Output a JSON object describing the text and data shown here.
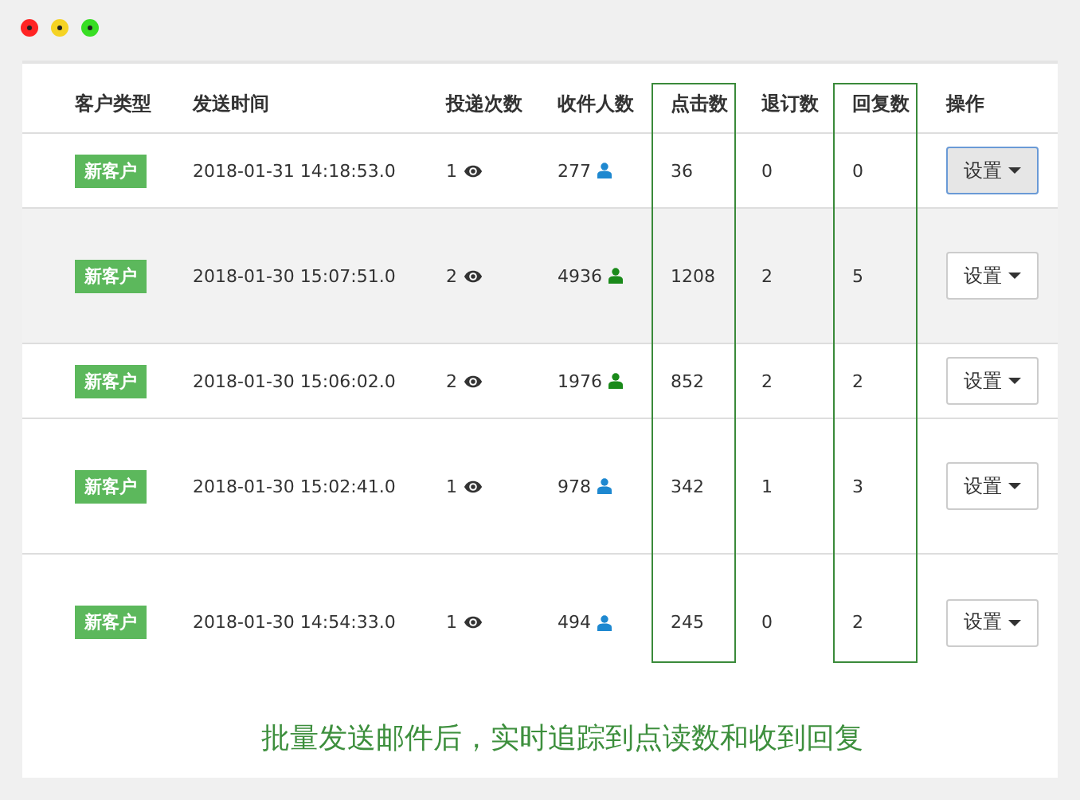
{
  "window_controls": [
    {
      "color": "#ff2424"
    },
    {
      "color": "#f5d324"
    },
    {
      "color": "#38de24"
    }
  ],
  "table": {
    "columns": [
      {
        "label": "客户类型",
        "highlighted": false
      },
      {
        "label": "发送时间",
        "highlighted": false
      },
      {
        "label": "投递次数",
        "highlighted": false
      },
      {
        "label": "收件人数",
        "highlighted": false
      },
      {
        "label": "点击数",
        "highlighted": true
      },
      {
        "label": "退订数",
        "highlighted": false
      },
      {
        "label": "回复数",
        "highlighted": true
      },
      {
        "label": "操作",
        "highlighted": false
      }
    ],
    "rows": [
      {
        "type": "新客户",
        "time": "2018-01-31 14:18:53.0",
        "deliveries": "1",
        "recipients": "277",
        "color": "#1e88d0",
        "clicks": "36",
        "unsubscribes": "0",
        "replies": "0",
        "action": "设置",
        "focused": true,
        "shaded": false,
        "tall": false
      },
      {
        "type": "新客户",
        "time": "2018-01-30 15:07:51.0",
        "deliveries": "2",
        "recipients": "4936",
        "color": "#1a8a1a",
        "clicks": "1208",
        "unsubscribes": "2",
        "replies": "5",
        "action": "设置",
        "focused": false,
        "shaded": true,
        "tall": true
      },
      {
        "type": "新客户",
        "time": "2018-01-30 15:06:02.0",
        "deliveries": "2",
        "recipients": "1976",
        "color": "#1a8a1a",
        "clicks": "852",
        "unsubscribes": "2",
        "replies": "2",
        "action": "设置",
        "focused": false,
        "shaded": false,
        "tall": false
      },
      {
        "type": "新客户",
        "time": "2018-01-30 15:02:41.0",
        "deliveries": "1",
        "recipients": "978",
        "color": "#1e88d0",
        "clicks": "342",
        "unsubscribes": "1",
        "replies": "3",
        "action": "设置",
        "focused": false,
        "shaded": false,
        "tall": true
      },
      {
        "type": "新客户",
        "time": "2018-01-30 14:54:33.0",
        "deliveries": "1",
        "recipients": "494",
        "color": "#1e88d0",
        "clicks": "245",
        "unsubscribes": "0",
        "replies": "2",
        "action": "设置",
        "focused": false,
        "shaded": false,
        "tall": true
      }
    ]
  },
  "caption": "批量发送邮件后，实时追踪到点读数和收到回复"
}
